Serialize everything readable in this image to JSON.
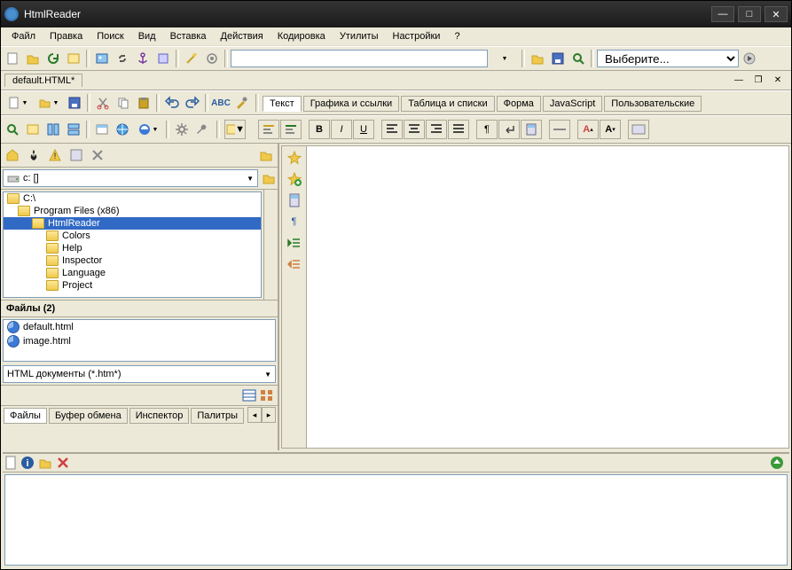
{
  "window": {
    "title": "HtmlReader"
  },
  "menu": [
    "Файл",
    "Правка",
    "Поиск",
    "Вид",
    "Вставка",
    "Действия",
    "Кодировка",
    "Утилиты",
    "Настройки",
    "?"
  ],
  "top_combo_placeholder": "Выберите...",
  "doc_tab": "default.HTML*",
  "editor_tabs": [
    "Текст",
    "Графика и ссылки",
    "Таблица и списки",
    "Форма",
    "JavaScript",
    "Пользовательские"
  ],
  "active_editor_tab": 0,
  "drive": "c: []",
  "tree": [
    {
      "label": "C:\\",
      "indent": 0,
      "sel": false
    },
    {
      "label": "Program Files (x86)",
      "indent": 1,
      "sel": false
    },
    {
      "label": "HtmlReader",
      "indent": 2,
      "sel": true
    },
    {
      "label": "Colors",
      "indent": 3,
      "sel": false
    },
    {
      "label": "Help",
      "indent": 3,
      "sel": false
    },
    {
      "label": "Inspector",
      "indent": 3,
      "sel": false
    },
    {
      "label": "Language",
      "indent": 3,
      "sel": false
    },
    {
      "label": "Project",
      "indent": 3,
      "sel": false
    }
  ],
  "files_header": "Файлы (2)",
  "files": [
    "default.html",
    "image.html"
  ],
  "filter": "HTML документы (*.htm*)",
  "left_tabs": [
    "Файлы",
    "Буфер обмена",
    "Инспектор",
    "Палитры"
  ],
  "active_left_tab": 0
}
